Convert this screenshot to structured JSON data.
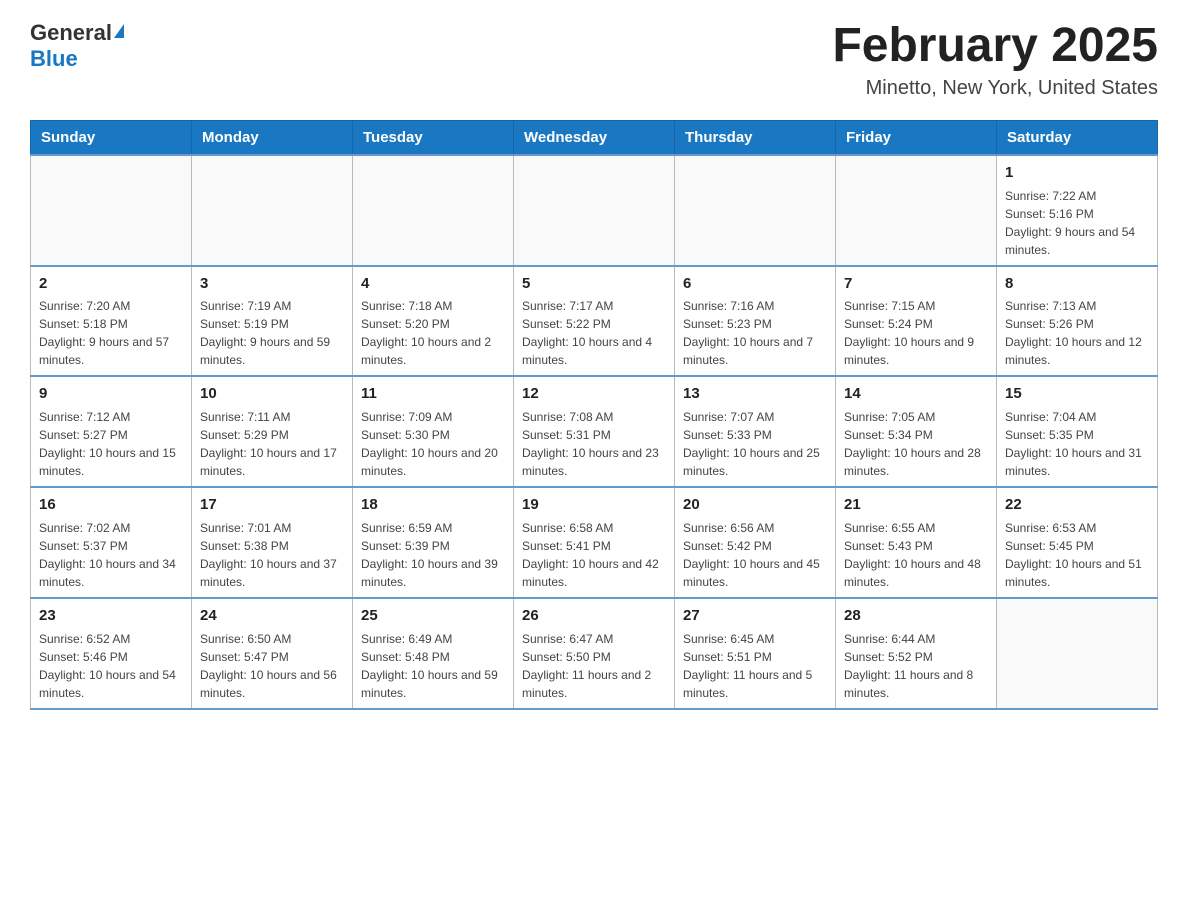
{
  "header": {
    "logo_general": "General",
    "logo_blue": "Blue",
    "month_title": "February 2025",
    "location": "Minetto, New York, United States"
  },
  "weekdays": [
    "Sunday",
    "Monday",
    "Tuesday",
    "Wednesday",
    "Thursday",
    "Friday",
    "Saturday"
  ],
  "weeks": [
    [
      {
        "day": "",
        "info": ""
      },
      {
        "day": "",
        "info": ""
      },
      {
        "day": "",
        "info": ""
      },
      {
        "day": "",
        "info": ""
      },
      {
        "day": "",
        "info": ""
      },
      {
        "day": "",
        "info": ""
      },
      {
        "day": "1",
        "info": "Sunrise: 7:22 AM\nSunset: 5:16 PM\nDaylight: 9 hours and 54 minutes."
      }
    ],
    [
      {
        "day": "2",
        "info": "Sunrise: 7:20 AM\nSunset: 5:18 PM\nDaylight: 9 hours and 57 minutes."
      },
      {
        "day": "3",
        "info": "Sunrise: 7:19 AM\nSunset: 5:19 PM\nDaylight: 9 hours and 59 minutes."
      },
      {
        "day": "4",
        "info": "Sunrise: 7:18 AM\nSunset: 5:20 PM\nDaylight: 10 hours and 2 minutes."
      },
      {
        "day": "5",
        "info": "Sunrise: 7:17 AM\nSunset: 5:22 PM\nDaylight: 10 hours and 4 minutes."
      },
      {
        "day": "6",
        "info": "Sunrise: 7:16 AM\nSunset: 5:23 PM\nDaylight: 10 hours and 7 minutes."
      },
      {
        "day": "7",
        "info": "Sunrise: 7:15 AM\nSunset: 5:24 PM\nDaylight: 10 hours and 9 minutes."
      },
      {
        "day": "8",
        "info": "Sunrise: 7:13 AM\nSunset: 5:26 PM\nDaylight: 10 hours and 12 minutes."
      }
    ],
    [
      {
        "day": "9",
        "info": "Sunrise: 7:12 AM\nSunset: 5:27 PM\nDaylight: 10 hours and 15 minutes."
      },
      {
        "day": "10",
        "info": "Sunrise: 7:11 AM\nSunset: 5:29 PM\nDaylight: 10 hours and 17 minutes."
      },
      {
        "day": "11",
        "info": "Sunrise: 7:09 AM\nSunset: 5:30 PM\nDaylight: 10 hours and 20 minutes."
      },
      {
        "day": "12",
        "info": "Sunrise: 7:08 AM\nSunset: 5:31 PM\nDaylight: 10 hours and 23 minutes."
      },
      {
        "day": "13",
        "info": "Sunrise: 7:07 AM\nSunset: 5:33 PM\nDaylight: 10 hours and 25 minutes."
      },
      {
        "day": "14",
        "info": "Sunrise: 7:05 AM\nSunset: 5:34 PM\nDaylight: 10 hours and 28 minutes."
      },
      {
        "day": "15",
        "info": "Sunrise: 7:04 AM\nSunset: 5:35 PM\nDaylight: 10 hours and 31 minutes."
      }
    ],
    [
      {
        "day": "16",
        "info": "Sunrise: 7:02 AM\nSunset: 5:37 PM\nDaylight: 10 hours and 34 minutes."
      },
      {
        "day": "17",
        "info": "Sunrise: 7:01 AM\nSunset: 5:38 PM\nDaylight: 10 hours and 37 minutes."
      },
      {
        "day": "18",
        "info": "Sunrise: 6:59 AM\nSunset: 5:39 PM\nDaylight: 10 hours and 39 minutes."
      },
      {
        "day": "19",
        "info": "Sunrise: 6:58 AM\nSunset: 5:41 PM\nDaylight: 10 hours and 42 minutes."
      },
      {
        "day": "20",
        "info": "Sunrise: 6:56 AM\nSunset: 5:42 PM\nDaylight: 10 hours and 45 minutes."
      },
      {
        "day": "21",
        "info": "Sunrise: 6:55 AM\nSunset: 5:43 PM\nDaylight: 10 hours and 48 minutes."
      },
      {
        "day": "22",
        "info": "Sunrise: 6:53 AM\nSunset: 5:45 PM\nDaylight: 10 hours and 51 minutes."
      }
    ],
    [
      {
        "day": "23",
        "info": "Sunrise: 6:52 AM\nSunset: 5:46 PM\nDaylight: 10 hours and 54 minutes."
      },
      {
        "day": "24",
        "info": "Sunrise: 6:50 AM\nSunset: 5:47 PM\nDaylight: 10 hours and 56 minutes."
      },
      {
        "day": "25",
        "info": "Sunrise: 6:49 AM\nSunset: 5:48 PM\nDaylight: 10 hours and 59 minutes."
      },
      {
        "day": "26",
        "info": "Sunrise: 6:47 AM\nSunset: 5:50 PM\nDaylight: 11 hours and 2 minutes."
      },
      {
        "day": "27",
        "info": "Sunrise: 6:45 AM\nSunset: 5:51 PM\nDaylight: 11 hours and 5 minutes."
      },
      {
        "day": "28",
        "info": "Sunrise: 6:44 AM\nSunset: 5:52 PM\nDaylight: 11 hours and 8 minutes."
      },
      {
        "day": "",
        "info": ""
      }
    ]
  ]
}
